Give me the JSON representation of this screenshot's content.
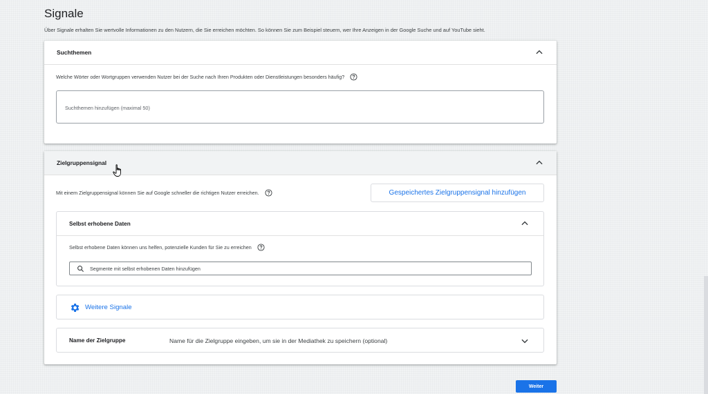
{
  "page": {
    "title": "Signale",
    "subtitle": "Über Signale erhalten Sie wertvolle Informationen zu den Nutzern, die Sie erreichen möchten. So können Sie zum Beispiel steuern, wer Ihre Anzeigen in der Google Suche und auf YouTube sieht."
  },
  "suchthemen": {
    "title": "Suchthemen",
    "question": "Welche Wörter oder Wortgruppen verwenden Nutzer bei der Suche nach Ihren Produkten oder Dienstleistungen besonders häufig?",
    "input_placeholder": "Suchthemen hinzufügen (maximal 50)"
  },
  "zielgruppensignal": {
    "title": "Zielgruppensignal",
    "description": "Mit einem Zielgruppensignal können Sie auf Google schneller die richtigen Nutzer erreichen.",
    "saved_button": "Gespeichertes Zielgruppensignal hinzufügen",
    "first_party": {
      "title": "Selbst erhobene Daten",
      "description": "Selbst erhobene Daten können uns helfen, potenzielle Kunden für Sie zu erreichen",
      "search_placeholder": "Segmente mit selbst erhobenen Daten hinzufügen"
    },
    "more_signals": "Weitere Signale",
    "audience_name": {
      "label": "Name der Zielgruppe",
      "hint": "Name für die Zielgruppe eingeben, um sie in der Mediathek zu speichern (optional)"
    }
  },
  "footer": {
    "next_button": "Weiter"
  },
  "colors": {
    "accent": "#1a73e8",
    "header_grey": "#f1f3f4"
  },
  "icons": [
    "chevron-up-icon",
    "chevron-down-icon",
    "help-icon",
    "search-icon",
    "gear-icon",
    "hand-cursor-icon"
  ]
}
